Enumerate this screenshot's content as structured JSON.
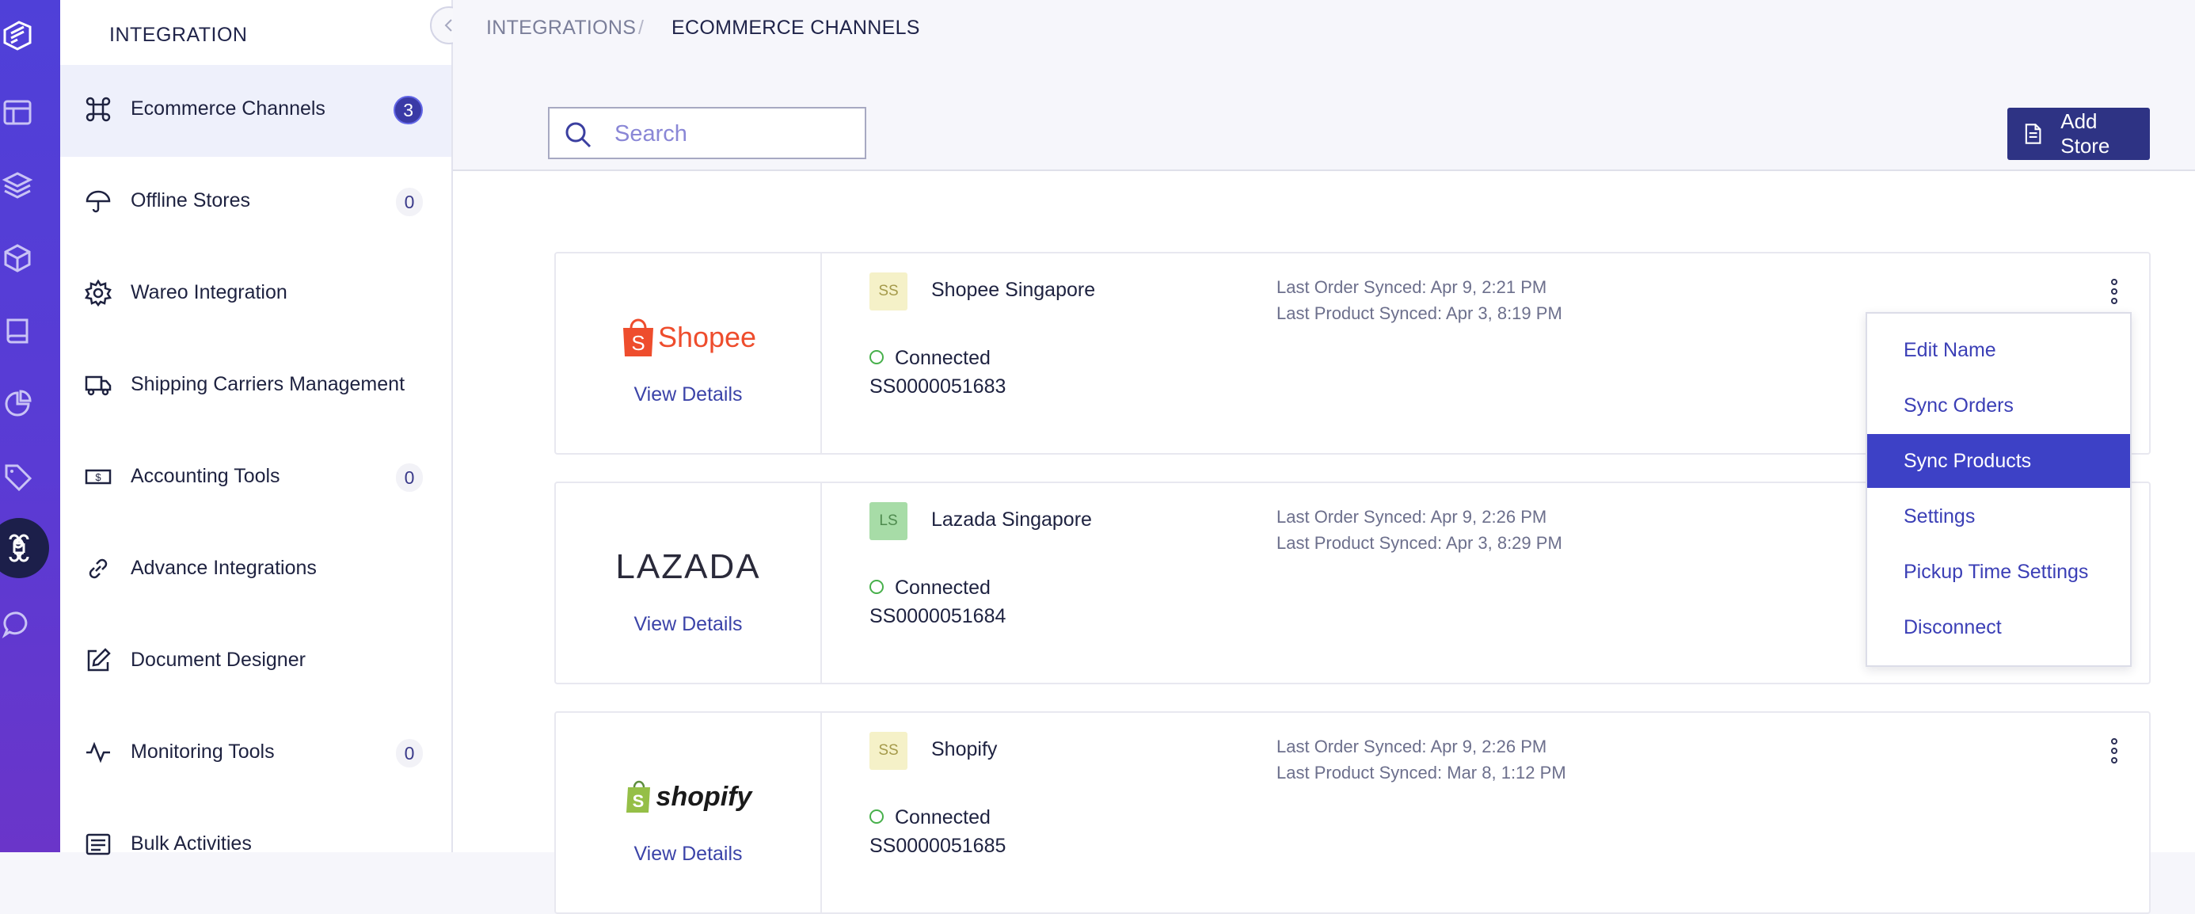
{
  "sidebar": {
    "title": "INTEGRATION",
    "items": [
      {
        "label": "Ecommerce Channels",
        "badge": "3",
        "icon": "command-icon"
      },
      {
        "label": "Offline Stores",
        "badge": "0",
        "icon": "umbrella-icon"
      },
      {
        "label": "Wareo Integration",
        "badge": "",
        "icon": "gear-icon"
      },
      {
        "label": "Shipping Carriers Management",
        "badge": "",
        "icon": "truck-icon"
      },
      {
        "label": "Accounting Tools",
        "badge": "0",
        "icon": "money-icon"
      },
      {
        "label": "Advance Integrations",
        "badge": "",
        "icon": "link-icon"
      },
      {
        "label": "Document Designer",
        "badge": "",
        "icon": "edit-icon"
      },
      {
        "label": "Monitoring Tools",
        "badge": "0",
        "icon": "activity-icon"
      },
      {
        "label": "Bulk Activities",
        "badge": "",
        "icon": "list-icon"
      }
    ]
  },
  "breadcrumb": {
    "parent": "INTEGRATIONS",
    "separator": "/",
    "current": "ECOMMERCE CHANNELS"
  },
  "search": {
    "placeholder": "Search",
    "value": ""
  },
  "toolbar": {
    "add_store_label": "Add Store"
  },
  "stores": [
    {
      "logo": "Shopee",
      "view_details": "View Details",
      "avatar": "SS",
      "name": "Shopee Singapore",
      "status": "Connected",
      "id": "SS0000051683",
      "last_order_label": "Last Order Synced:",
      "last_order": "Apr 9, 2:21 PM",
      "last_product_label": "Last Product Synced:",
      "last_product": "Apr 3, 8:19 PM"
    },
    {
      "logo": "LAZADA",
      "view_details": "View Details",
      "avatar": "LS",
      "name": "Lazada Singapore",
      "status": "Connected",
      "id": "SS0000051684",
      "last_order_label": "Last Order Synced:",
      "last_order": "Apr 9, 2:26 PM",
      "last_product_label": "Last Product Synced:",
      "last_product": "Apr 3, 8:29 PM"
    },
    {
      "logo": "shopify",
      "view_details": "View Details",
      "avatar": "SS",
      "name": "Shopify",
      "status": "Connected",
      "id": "SS0000051685",
      "last_order_label": "Last Order Synced:",
      "last_order": "Apr 9, 2:26 PM",
      "last_product_label": "Last Product Synced:",
      "last_product": "Mar 8, 1:12 PM"
    }
  ],
  "context_menu": {
    "items": [
      "Edit Name",
      "Sync Orders",
      "Sync Products",
      "Settings",
      "Pickup Time Settings",
      "Disconnect"
    ],
    "highlighted": "Sync Products"
  },
  "colors": {
    "rail": "#5a3bd4",
    "accent": "#3d41c6",
    "add_store": "#2e3384",
    "connected": "#47b04b",
    "shopee": "#ee4d2d",
    "shopify": "#95bf47"
  }
}
